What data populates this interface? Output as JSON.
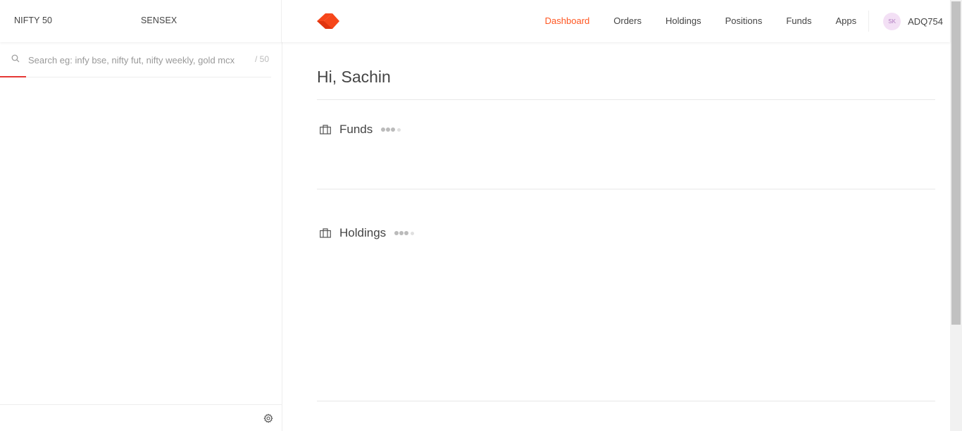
{
  "indices": [
    {
      "name": "NIFTY 50"
    },
    {
      "name": "SENSEX"
    }
  ],
  "nav": {
    "items": [
      {
        "label": "Dashboard",
        "active": true
      },
      {
        "label": "Orders",
        "active": false
      },
      {
        "label": "Holdings",
        "active": false
      },
      {
        "label": "Positions",
        "active": false
      },
      {
        "label": "Funds",
        "active": false
      },
      {
        "label": "Apps",
        "active": false
      }
    ]
  },
  "user": {
    "initials": "SK",
    "id": "ADQ754"
  },
  "search": {
    "placeholder": "Search eg: infy bse, nifty fut, nifty weekly, gold mcx",
    "value": "",
    "count": "/ 50"
  },
  "main": {
    "greeting": "Hi, Sachin",
    "sections": [
      {
        "label": "Funds",
        "icon": "briefcase-icon"
      },
      {
        "label": "Holdings",
        "icon": "briefcase-icon"
      }
    ]
  },
  "colors": {
    "accent": "#ff5722",
    "search_underline": "#e53935"
  }
}
